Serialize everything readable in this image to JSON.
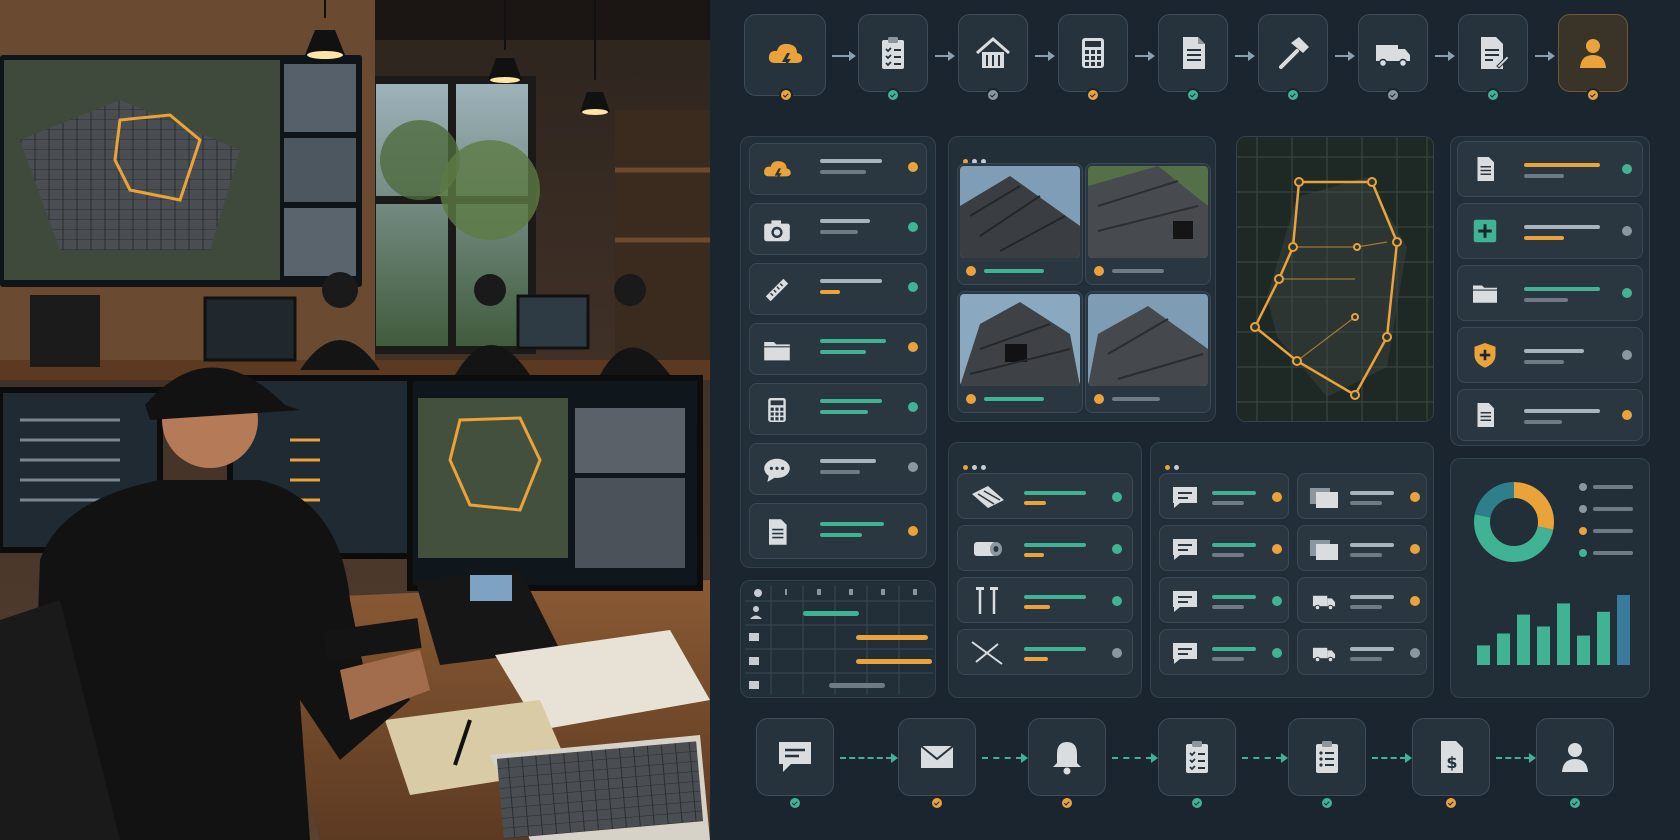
{
  "scene": {
    "description_hidden": "",
    "colors": {
      "accent_orange": "#e9a33a",
      "accent_green": "#3fb394",
      "panel": "#222e38",
      "background": "#1a2530",
      "muted": "#8c969e"
    }
  },
  "workflow_top": {
    "steps": [
      {
        "icon": "storm-cloud-icon",
        "status": "orange"
      },
      {
        "icon": "clipboard-checklist-icon",
        "status": "green"
      },
      {
        "icon": "house-icon",
        "status": "gray"
      },
      {
        "icon": "calculator-icon",
        "status": "orange-solid"
      },
      {
        "icon": "document-icon",
        "status": "green"
      },
      {
        "icon": "hammer-icon",
        "status": "green"
      },
      {
        "icon": "truck-icon",
        "status": "gray"
      },
      {
        "icon": "document-sign-icon",
        "status": "green"
      },
      {
        "icon": "user-icon",
        "status": "orange",
        "highlight": true
      }
    ]
  },
  "intake_list": {
    "items": [
      {
        "icon": "storm-cloud-icon",
        "status": "orange"
      },
      {
        "icon": "camera-icon",
        "status": "green"
      },
      {
        "icon": "ruler-icon",
        "status": "green"
      },
      {
        "icon": "folder-icon",
        "status": "orange"
      },
      {
        "icon": "calculator-icon",
        "status": "green"
      },
      {
        "icon": "chat-bubble-icon",
        "status": "gray"
      },
      {
        "icon": "document-icon",
        "status": "orange"
      }
    ]
  },
  "photo_grid": {
    "count": 4,
    "statuses": [
      "orange",
      "orange",
      "orange",
      "orange"
    ]
  },
  "roof_map": {
    "overlay": "outline-polygon"
  },
  "docs_list": {
    "items": [
      {
        "icon": "document-icon",
        "status": "green"
      },
      {
        "icon": "medical-plus-icon",
        "status": "gray"
      },
      {
        "icon": "folder-icon",
        "status": "green"
      },
      {
        "icon": "shield-icon",
        "status": "gray"
      },
      {
        "icon": "document-icon",
        "status": "orange"
      }
    ]
  },
  "materials": {
    "items": [
      {
        "icon": "shingle-icon",
        "status": "green"
      },
      {
        "icon": "roll-icon",
        "status": "green"
      },
      {
        "icon": "nails-icon",
        "status": "green"
      },
      {
        "icon": "tools-icon",
        "status": "gray"
      }
    ]
  },
  "messages": {
    "left": [
      {
        "status": "orange"
      },
      {
        "status": "orange"
      },
      {
        "status": "green"
      },
      {
        "status": "green"
      }
    ],
    "right": [
      {
        "icon": "docs-stack-icon",
        "status": "orange"
      },
      {
        "icon": "docs-stack-icon",
        "status": "orange"
      },
      {
        "icon": "truck-icon",
        "status": "orange"
      },
      {
        "icon": "truck-icon",
        "status": "gray"
      }
    ]
  },
  "analytics": {
    "donut": [
      {
        "color": "#e9a33a",
        "share": 0.28
      },
      {
        "color": "#3fb394",
        "share": 0.5
      },
      {
        "color": "#2f7f8a",
        "share": 0.22
      }
    ],
    "bars": [
      0.28,
      0.45,
      0.72,
      0.55,
      0.88,
      0.42,
      0.76,
      1.0
    ]
  },
  "schedule": {
    "rows": 4
  },
  "workflow_bottom": {
    "steps": [
      {
        "icon": "message-icon",
        "status": "green"
      },
      {
        "icon": "envelope-icon",
        "status": "orange"
      },
      {
        "icon": "bell-icon",
        "status": "orange"
      },
      {
        "icon": "clipboard-check-icon",
        "status": "green"
      },
      {
        "icon": "clipboard-list-icon",
        "status": "green"
      },
      {
        "icon": "invoice-dollar-icon",
        "status": "orange"
      },
      {
        "icon": "user-icon",
        "status": "green"
      }
    ]
  }
}
